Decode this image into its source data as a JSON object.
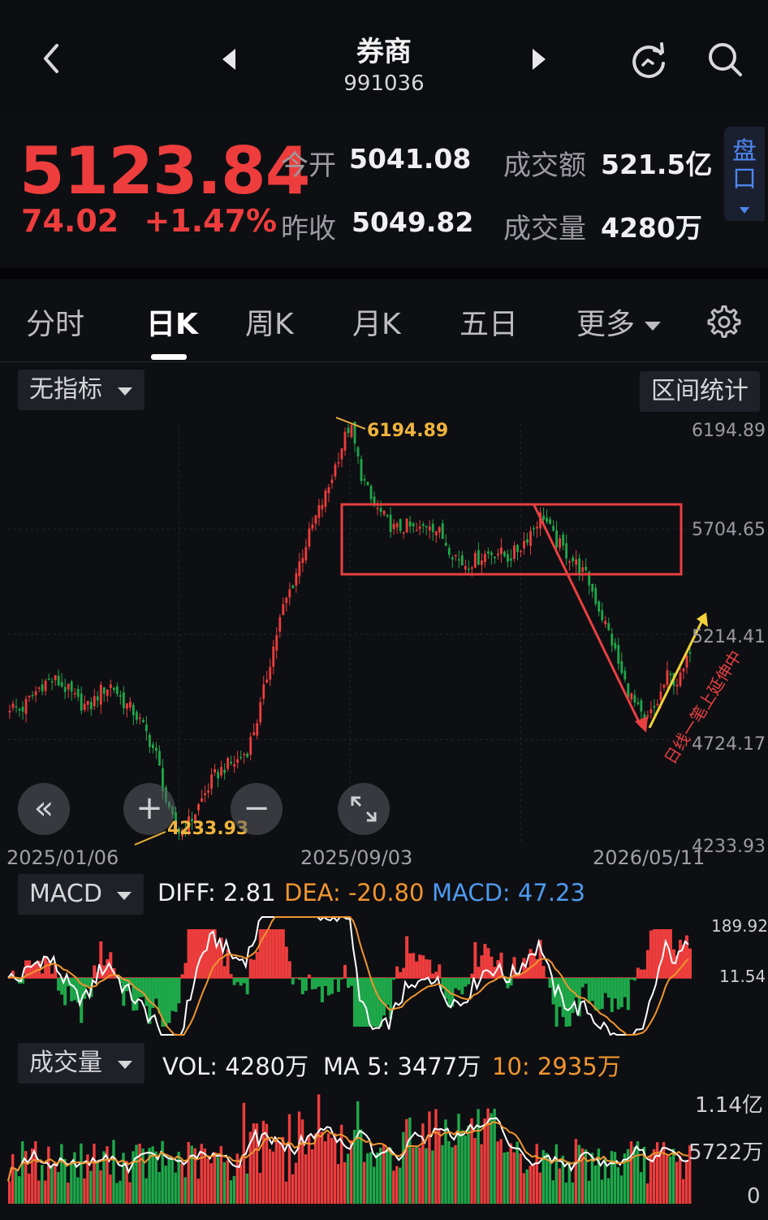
{
  "header": {
    "title": "券商",
    "code": "991036",
    "back_icon": "chevron-left-icon",
    "prev_icon": "triangle-left-icon",
    "next_icon": "triangle-right-icon",
    "refresh_icon": "refresh-icon",
    "search_icon": "search-icon"
  },
  "quote": {
    "price": "5123.84",
    "change": "74.02",
    "change_pct": "+1.47%",
    "open_label": "今开",
    "open_value": "5041.08",
    "prev_close_label": "昨收",
    "prev_close_value": "5049.82",
    "amount_label": "成交额",
    "amount_value": "521.5亿",
    "volume_label": "成交量",
    "volume_value": "4280万",
    "pankou_label_1": "盘",
    "pankou_label_2": "口",
    "up_color": "#ee3d3d",
    "down_color": "#1ea84a"
  },
  "tabs": {
    "items": [
      "分时",
      "日K",
      "周K",
      "月K",
      "五日",
      "更多"
    ],
    "active": "日K",
    "settings_icon": "gear-icon"
  },
  "kline": {
    "indicator_label": "无指标",
    "stats_button": "区间统计",
    "y_ticks": [
      "6194.89",
      "5704.65",
      "5214.41",
      "4724.17",
      "4233.93"
    ],
    "high_label": "6194.89",
    "low_label": "4233.93",
    "dates": [
      "2025/01/06",
      "2025/09/03",
      "2026/05/11"
    ],
    "annotation": "日线一笔上延伸中",
    "controls": [
      "rewind-icon",
      "zoom-in-icon",
      "zoom-out-icon",
      "expand-icon"
    ]
  },
  "macd": {
    "label": "MACD",
    "diff_label": "DIFF: 2.81",
    "dea_label": "DEA: -20.80",
    "macd_label": "MACD: 47.23",
    "y_ticks": [
      "189.92",
      "11.54"
    ],
    "diff_color": "#ffffff",
    "dea_color": "#f0952f",
    "macd_color": "#4d9bf0"
  },
  "volume": {
    "label": "成交量",
    "vol_label": "VOL: 4280万",
    "ma5_label": "MA 5: 3477万",
    "ma10_label": "10: 2935万",
    "y_ticks": [
      "1.14亿",
      "5722万",
      "0"
    ]
  },
  "chart_data": {
    "type": "candlestick",
    "title": "",
    "x_range": [
      "2025/01/06",
      "2026/05/11"
    ],
    "ylim": [
      4233.93,
      6194.89
    ],
    "close_series_approx": [
      4880,
      4860,
      4930,
      4990,
      5000,
      4960,
      4900,
      4870,
      4950,
      4980,
      4900,
      4850,
      4760,
      4640,
      4380,
      4290,
      4350,
      4450,
      4550,
      4600,
      4620,
      4680,
      4850,
      5100,
      5320,
      5460,
      5620,
      5760,
      5880,
      6050,
      6194,
      5960,
      5820,
      5760,
      5700,
      5720,
      5690,
      5740,
      5680,
      5600,
      5540,
      5560,
      5590,
      5600,
      5570,
      5620,
      5700,
      5780,
      5660,
      5600,
      5540,
      5470,
      5330,
      5200,
      5020,
      4900,
      4800,
      4880,
      5020,
      4990,
      5123.84
    ],
    "high": 6194.89,
    "low": 4233.93,
    "last_close": 5123.84
  }
}
